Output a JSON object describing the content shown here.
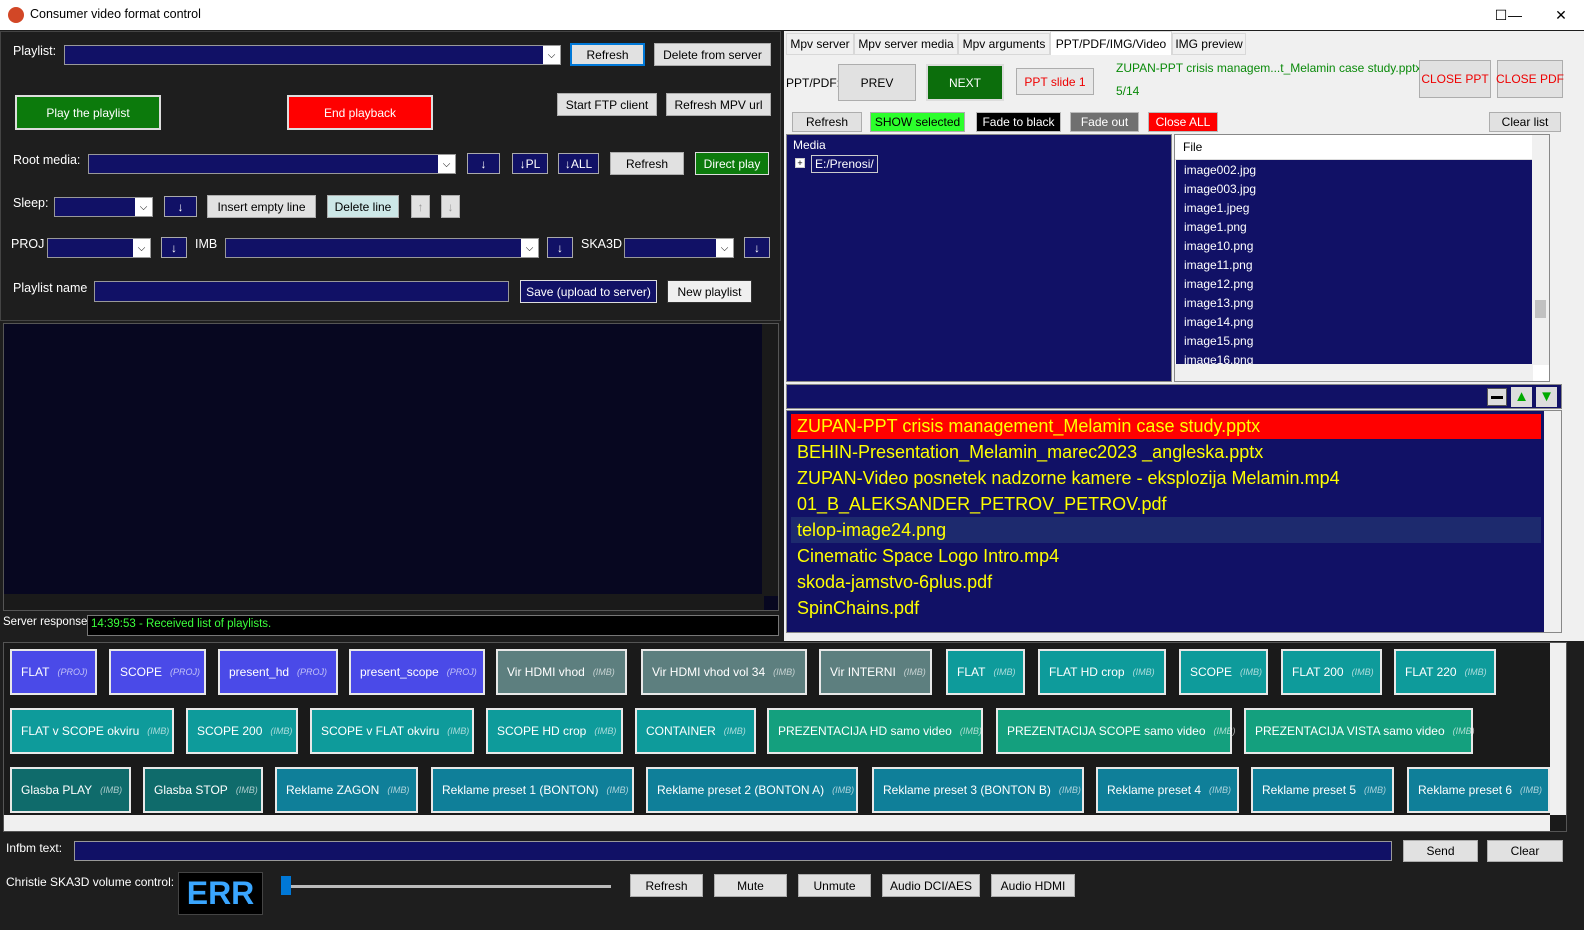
{
  "window": {
    "title": "Consumer video format control",
    "min": "—",
    "max": "☐",
    "close": "✕"
  },
  "left": {
    "playlist_label": "Playlist:",
    "refresh": "Refresh",
    "delete_from_server": "Delete from server",
    "play_playlist": "Play the playlist",
    "end_playback": "End playback",
    "start_ftp": "Start FTP client",
    "refresh_mpv_url": "Refresh MPV url",
    "root_media_label": "Root media:",
    "arrow": "↓",
    "arrow_pl": "↓PL",
    "arrow_all": "↓ALL",
    "refresh2": "Refresh",
    "direct_play": "Direct play",
    "sleep_label": "Sleep:",
    "insert_empty_line": "Insert empty line",
    "delete_line": "Delete line",
    "up_small": "↑",
    "down_small": "↓",
    "proj_label": "PROJ",
    "imb_label": "IMB",
    "ska3d_label": "SKA3D",
    "playlist_name_label": "Playlist name",
    "save_upload": "Save (upload to server)",
    "new_playlist": "New playlist",
    "server_response_label": "Server response:",
    "server_response": "14:39:53 - Received list of playlists."
  },
  "right": {
    "tabs": [
      "Mpv server",
      "Mpv server media",
      "Mpv arguments",
      "PPT/PDF/IMG/Video",
      "IMG preview"
    ],
    "ppt_pdf_label": "PPT/PDF:",
    "prev": "PREV",
    "next": "NEXT",
    "ppt_slide": "PPT slide 1",
    "current_file": "ZUPAN-PPT crisis managem...t_Melamin case study.pptx",
    "page_counter": "5/14",
    "close_ppt": "CLOSE PPT",
    "close_pdf": "CLOSE PDF",
    "refresh": "Refresh",
    "show_selected": "SHOW selected",
    "fade_black": "Fade to black",
    "fade_out": "Fade out",
    "close_all": "Close ALL",
    "clear_list": "Clear list",
    "media_header": "Media",
    "media_root": "E:/Prenosi/",
    "file_header": "File",
    "files": [
      "image002.jpg",
      "image003.jpg",
      "image1.jpeg",
      "image1.png",
      "image10.png",
      "image11.png",
      "image12.png",
      "image13.png",
      "image14.png",
      "image15.png",
      "image16.png"
    ],
    "queue": [
      "ZUPAN-PPT crisis management_Melamin case study.pptx",
      "BEHIN-Presentation_Melamin_marec2023 _angleska.pptx",
      "ZUPAN-Video posnetek nadzorne kamere - eksplozija Melamin.mp4",
      "01_B_ALEKSANDER_PETROV_PETROV.pdf",
      "telop-image24.png",
      "Cinematic Space Logo Intro.mp4",
      "skoda-jamstvo-6plus.pdf",
      "SpinChains.pdf"
    ]
  },
  "presets": {
    "row1": [
      {
        "label": "FLAT",
        "tag": "(PROJ)"
      },
      {
        "label": "SCOPE",
        "tag": "(PROJ)"
      },
      {
        "label": "present_hd",
        "tag": "(PROJ)"
      },
      {
        "label": "present_scope",
        "tag": "(PROJ)"
      },
      {
        "label": "Vir HDMI vhod",
        "tag": "(IMB)"
      },
      {
        "label": "Vir HDMI vhod vol 34",
        "tag": "(IMB)"
      },
      {
        "label": "Vir INTERNI",
        "tag": "(IMB)"
      },
      {
        "label": "FLAT",
        "tag": "(IMB)"
      },
      {
        "label": "FLAT HD crop",
        "tag": "(IMB)"
      },
      {
        "label": "SCOPE",
        "tag": "(IMB)"
      },
      {
        "label": "FLAT 200",
        "tag": "(IMB)"
      },
      {
        "label": "FLAT 220",
        "tag": "(IMB)"
      }
    ],
    "row2": [
      {
        "label": "FLAT v SCOPE okviru",
        "tag": "(IMB)"
      },
      {
        "label": "SCOPE 200",
        "tag": "(IMB)"
      },
      {
        "label": "SCOPE v FLAT okviru",
        "tag": "(IMB)"
      },
      {
        "label": "SCOPE HD crop",
        "tag": "(IMB)"
      },
      {
        "label": "CONTAINER",
        "tag": "(IMB)"
      },
      {
        "label": "PREZENTACIJA HD samo video",
        "tag": "(IMB)"
      },
      {
        "label": "PREZENTACIJA SCOPE samo video",
        "tag": "(IMB)"
      },
      {
        "label": "PREZENTACIJA VISTA samo video",
        "tag": "(IMB)"
      }
    ],
    "row3": [
      {
        "label": "Glasba PLAY",
        "tag": "(IMB)"
      },
      {
        "label": "Glasba STOP",
        "tag": "(IMB)"
      },
      {
        "label": "Reklame ZAGON",
        "tag": "(IMB)"
      },
      {
        "label": "Reklame preset 1 (BONTON)",
        "tag": "(IMB)"
      },
      {
        "label": "Reklame preset 2 (BONTON A)",
        "tag": "(IMB)"
      },
      {
        "label": "Reklame preset 3 (BONTON B)",
        "tag": "(IMB)"
      },
      {
        "label": "Reklame preset 4",
        "tag": "(IMB)"
      },
      {
        "label": "Reklame preset 5",
        "tag": "(IMB)"
      },
      {
        "label": "Reklame preset 6",
        "tag": "(IMB)"
      }
    ]
  },
  "bottom": {
    "infbm_label": "Infbm text:",
    "send": "Send",
    "clear": "Clear",
    "volume_label": "Christie SKA3D volume control:",
    "volume_value": "ERR",
    "refresh": "Refresh",
    "mute": "Mute",
    "unmute": "Unmute",
    "audio_dci": "Audio DCI/AES",
    "audio_hdmi": "Audio HDMI"
  }
}
